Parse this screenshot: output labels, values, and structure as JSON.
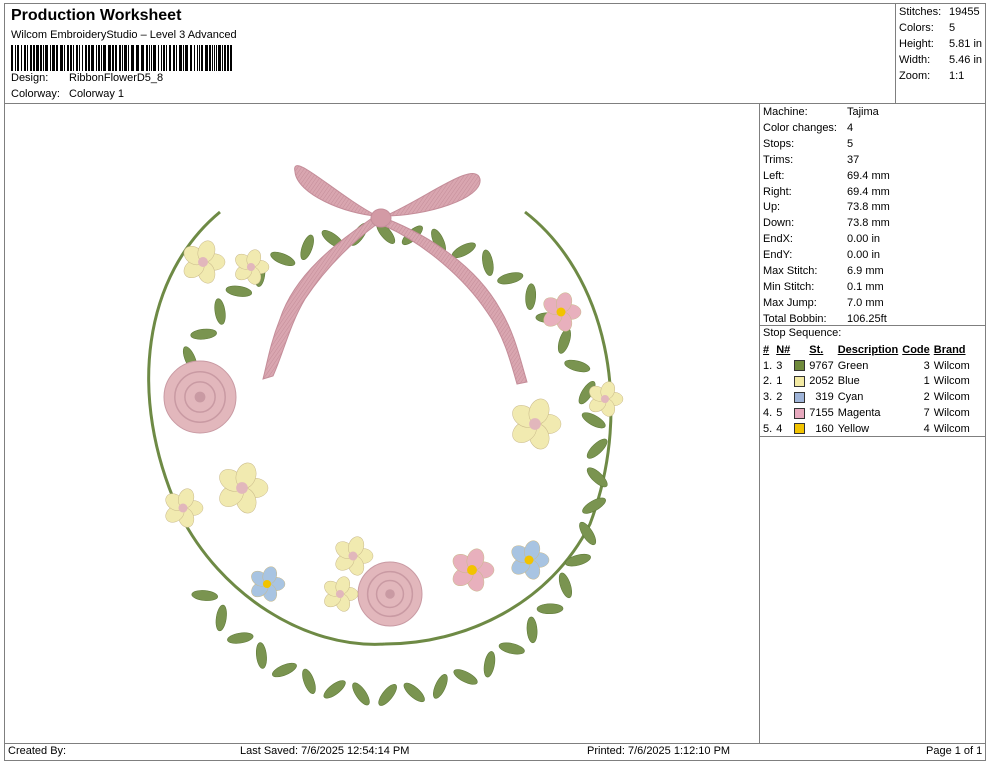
{
  "header": {
    "title": "Production Worksheet",
    "subtitle": "Wilcom EmbroideryStudio – Level 3 Advanced",
    "design_label": "Design:",
    "design_value": "RibbonFlowerD5_8",
    "colorway_label": "Colorway:",
    "colorway_value": "Colorway 1"
  },
  "stats": [
    {
      "label": "Stitches:",
      "value": "19455"
    },
    {
      "label": "Colors:",
      "value": "5"
    },
    {
      "label": "Height:",
      "value": "5.81 in"
    },
    {
      "label": "Width:",
      "value": "5.46 in"
    },
    {
      "label": "Zoom:",
      "value": "1:1"
    }
  ],
  "machine_info": [
    {
      "label": "Machine:",
      "value": "Tajima"
    },
    {
      "label": "Color changes:",
      "value": "4"
    },
    {
      "label": "Stops:",
      "value": "5"
    },
    {
      "label": "Trims:",
      "value": "37"
    },
    {
      "label": "Left:",
      "value": "69.4 mm"
    },
    {
      "label": "Right:",
      "value": "69.4 mm"
    },
    {
      "label": "Up:",
      "value": "73.8 mm"
    },
    {
      "label": "Down:",
      "value": "73.8 mm"
    },
    {
      "label": "EndX:",
      "value": "0.00 in"
    },
    {
      "label": "EndY:",
      "value": "0.00 in"
    },
    {
      "label": "Max Stitch:",
      "value": "6.9 mm"
    },
    {
      "label": "Min Stitch:",
      "value": "0.1 mm"
    },
    {
      "label": "Max Jump:",
      "value": "7.0 mm"
    },
    {
      "label": "Total Bobbin:",
      "value": "106.25ft"
    }
  ],
  "stop_sequence": {
    "title": "Stop Sequence:",
    "headers": [
      "#",
      "N#",
      "St.",
      "Description",
      "Code",
      "Brand"
    ],
    "rows": [
      {
        "index": "1.",
        "n": "3",
        "color": "#6f8a3c",
        "st": "9767",
        "desc": "Green",
        "code": "3",
        "brand": "Wilcom"
      },
      {
        "index": "2.",
        "n": "1",
        "color": "#f3eaa3",
        "st": "2052",
        "desc": "Blue",
        "code": "1",
        "brand": "Wilcom"
      },
      {
        "index": "3.",
        "n": "2",
        "color": "#9fb4d8",
        "st": "319",
        "desc": "Cyan",
        "code": "2",
        "brand": "Wilcom"
      },
      {
        "index": "4.",
        "n": "5",
        "color": "#e7a9be",
        "st": "7155",
        "desc": "Magenta",
        "code": "7",
        "brand": "Wilcom"
      },
      {
        "index": "5.",
        "n": "4",
        "color": "#f2c300",
        "st": "160",
        "desc": "Yellow",
        "code": "4",
        "brand": "Wilcom"
      }
    ]
  },
  "footer": {
    "created_by": "Created By:",
    "last_saved": "Last Saved: 7/6/2025 12:54:14 PM",
    "printed": "Printed: 7/6/2025 1:12:10 PM",
    "page": "Page 1 of 1"
  },
  "colors": {
    "leaf": "#7a9450",
    "stem": "#6e8a45",
    "ribbon": "#d7a3ac",
    "rose": "#e2b7bc",
    "cream": "#f1eab0",
    "blue_flower": "#a8c4e2",
    "pink_flower": "#e8b0bd",
    "center": "#f2c300"
  }
}
